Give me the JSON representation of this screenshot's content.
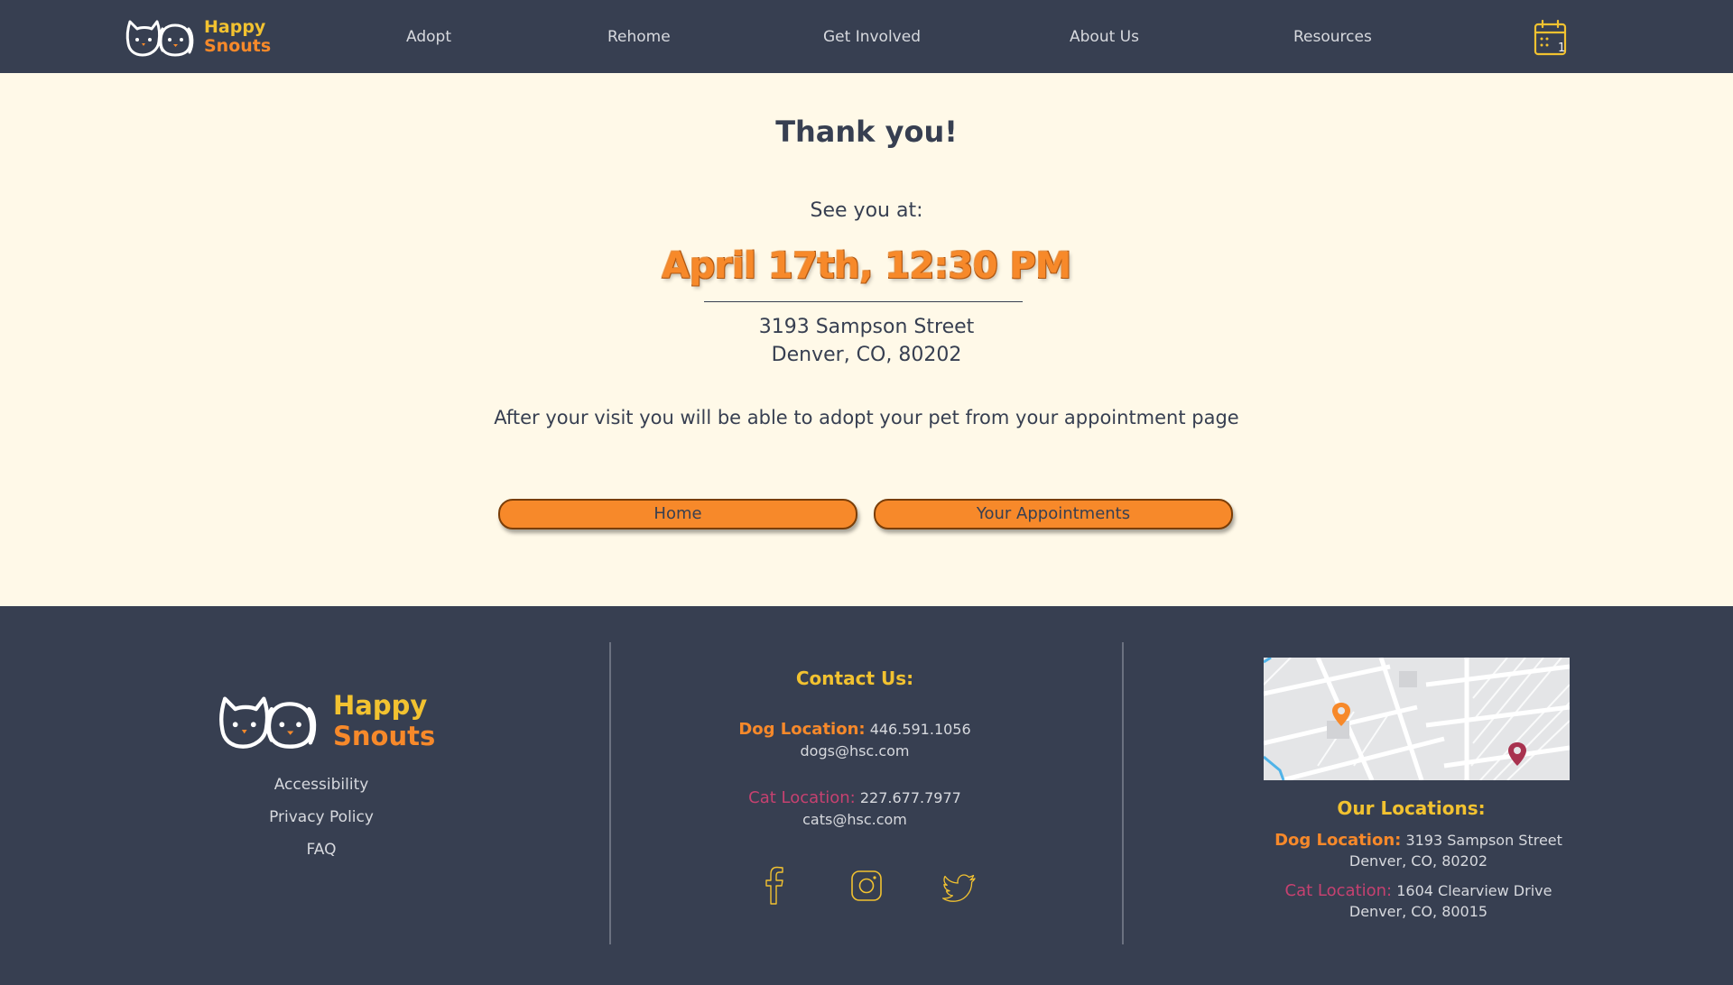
{
  "header": {
    "logo": {
      "line1": "Happy",
      "line2": "Snouts"
    },
    "nav": [
      {
        "label": "Adopt"
      },
      {
        "label": "Rehome"
      },
      {
        "label": "Get Involved"
      },
      {
        "label": "About Us"
      },
      {
        "label": "Resources"
      }
    ],
    "calendar_icon": "calendar-icon",
    "calendar_count": "1"
  },
  "main": {
    "title": "Thank you!",
    "see_you": "See you at:",
    "datetime": "April 17th, 12:30 PM",
    "address_line1": "3193 Sampson Street",
    "address_line2": "Denver, CO, 80202",
    "after_visit": "After your visit you will be able to adopt your pet from your appointment page",
    "buttons": {
      "home": "Home",
      "appointments": "Your Appointments"
    }
  },
  "footer": {
    "logo": {
      "line1": "Happy",
      "line2": "Snouts"
    },
    "links": [
      "Accessibility",
      "Privacy Policy",
      "FAQ"
    ],
    "contact": {
      "heading": "Contact Us:",
      "dog_label": "Dog Location:",
      "dog_phone": "446.591.1056",
      "dog_email": "dogs@hsc.com",
      "cat_label": "Cat Location:",
      "cat_phone": "227.677.7977",
      "cat_email": "cats@hsc.com"
    },
    "social": [
      "facebook-icon",
      "instagram-icon",
      "twitter-icon"
    ],
    "locations": {
      "heading": "Our Locations:",
      "dog_label": "Dog Location:",
      "dog_street": "3193 Sampson Street",
      "dog_city": "Denver, CO, 80202",
      "cat_label": "Cat Location:",
      "cat_street": "1604 Clearview Drive",
      "cat_city": "Denver, CO, 80015"
    }
  },
  "colors": {
    "dark": "#373F51",
    "cream": "#FFF9E8",
    "orange": "#F7892A",
    "yellow": "#F2C230",
    "cat_pink": "#C64170"
  }
}
